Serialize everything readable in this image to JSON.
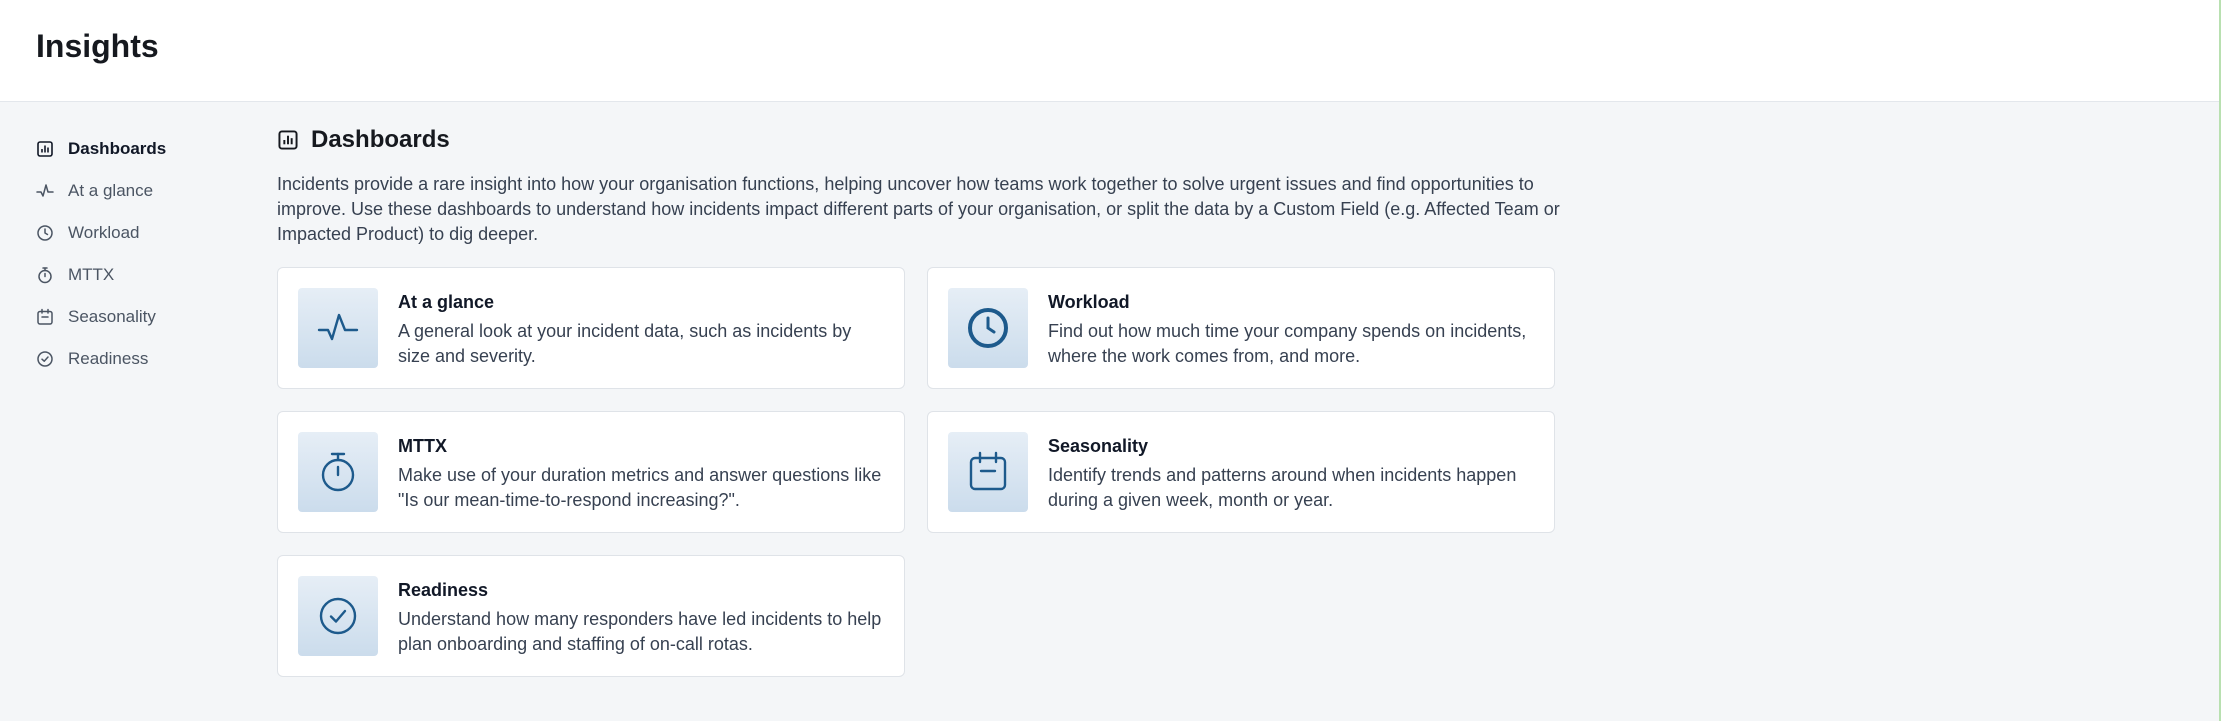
{
  "header": {
    "title": "Insights"
  },
  "sidebar": {
    "items": [
      {
        "label": "Dashboards",
        "icon": "dashboard-icon",
        "active": true
      },
      {
        "label": "At a glance",
        "icon": "pulse-icon"
      },
      {
        "label": "Workload",
        "icon": "clock-icon"
      },
      {
        "label": "MTTX",
        "icon": "stopwatch-icon"
      },
      {
        "label": "Seasonality",
        "icon": "calendar-icon"
      },
      {
        "label": "Readiness",
        "icon": "check-circle-icon"
      }
    ]
  },
  "main": {
    "title": "Dashboards",
    "intro": "Incidents provide a rare insight into how your organisation functions, helping uncover how teams work together to solve urgent issues and find opportunities to improve. Use these dashboards to understand how incidents impact different parts of your organisation, or split the data by a Custom Field (e.g. Affected Team or Impacted Product) to dig deeper.",
    "cards": [
      {
        "title": "At a glance",
        "description": "A general look at your incident data, such as incidents by size and severity.",
        "icon": "pulse-icon"
      },
      {
        "title": "Workload",
        "description": "Find out how much time your company spends on incidents, where the work comes from, and more.",
        "icon": "clock-icon"
      },
      {
        "title": "MTTX",
        "description": "Make use of your duration metrics and answer questions like \"Is our mean-time-to-respond increasing?\".",
        "icon": "stopwatch-icon"
      },
      {
        "title": "Seasonality",
        "description": "Identify trends and patterns around when incidents happen during a given week, month or year.",
        "icon": "calendar-icon"
      },
      {
        "title": "Readiness",
        "description": "Understand how many responders have led incidents to help plan onboarding and staffing of on-call rotas.",
        "icon": "check-circle-icon"
      }
    ]
  },
  "colors": {
    "accent": "#1d5a8c",
    "nav_icon": "#4b5563",
    "page_bg": "#f4f6f8"
  }
}
